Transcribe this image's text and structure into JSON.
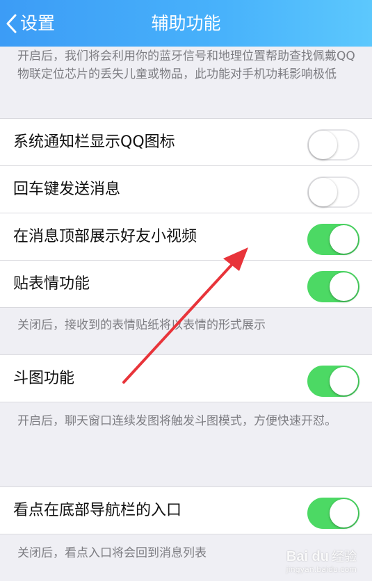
{
  "nav": {
    "back_label": "设置",
    "title": "辅助功能"
  },
  "notes": {
    "top": "开启后，我们将会利用你的蓝牙信号和地理位置帮助查找佩戴QQ物联定位芯片的丢失儿童或物品，此功能对手机功耗影响极低",
    "sticker": "关闭后，接收到的表情贴纸将以表情的形式展示",
    "doutu": "开启后，聊天窗口连续发图将触发斗图模式，方便快速开怼。",
    "kandian": "关闭后，看点入口将会回到消息列表"
  },
  "settings": [
    {
      "label": "系统通知栏显示QQ图标",
      "enabled": false
    },
    {
      "label": "回车键发送消息",
      "enabled": false
    },
    {
      "label": "在消息顶部展示好友小视频",
      "enabled": true
    },
    {
      "label": "贴表情功能",
      "enabled": true
    },
    {
      "label": "斗图功能",
      "enabled": true
    },
    {
      "label": "看点在底部导航栏的入口",
      "enabled": true
    }
  ],
  "watermark": {
    "logo": "Bai du",
    "text": "经验",
    "url": "jingyan.baidu.com"
  },
  "colors": {
    "nav": "#3c9cf6",
    "toggle_on": "#4cd964",
    "arrow": "#e8343a"
  }
}
